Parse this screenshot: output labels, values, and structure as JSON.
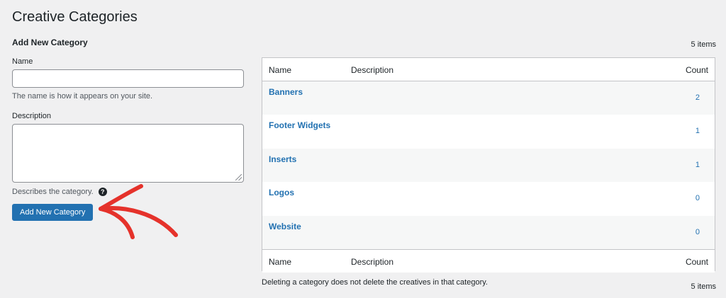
{
  "page": {
    "title": "Creative Categories"
  },
  "form": {
    "heading": "Add New Category",
    "name_label": "Name",
    "name_value": "",
    "name_help": "The name is how it appears on your site.",
    "description_label": "Description",
    "description_value": "",
    "description_help": "Describes the category.",
    "help_icon_glyph": "?",
    "submit_label": "Add New Category"
  },
  "table": {
    "items_count_top": "5 items",
    "items_count_bottom": "5 items",
    "columns": {
      "name": "Name",
      "description": "Description",
      "count": "Count"
    },
    "rows": [
      {
        "name": "Banners",
        "description": "",
        "count": "2"
      },
      {
        "name": "Footer Widgets",
        "description": "",
        "count": "1"
      },
      {
        "name": "Inserts",
        "description": "",
        "count": "1"
      },
      {
        "name": "Logos",
        "description": "",
        "count": "0"
      },
      {
        "name": "Website",
        "description": "",
        "count": "0"
      }
    ],
    "note": "Deleting a category does not delete the creatives in that category."
  },
  "colors": {
    "background": "#f0f0f1",
    "primary": "#2271b1",
    "arrow": "#e5322b"
  },
  "icons": [
    "help-icon",
    "annotation-arrow-icon",
    "resize-grip-icon"
  ]
}
